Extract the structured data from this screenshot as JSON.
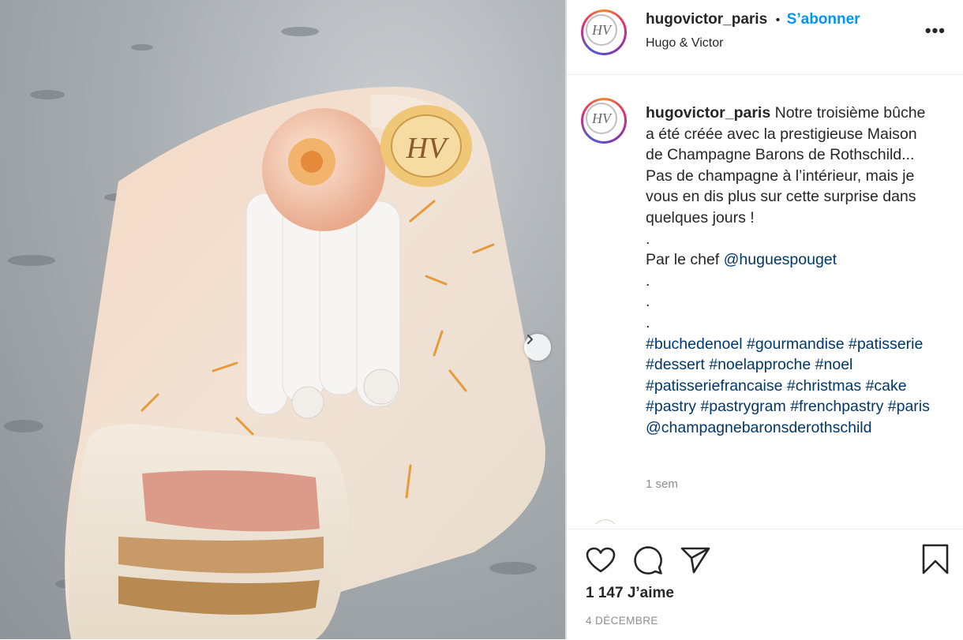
{
  "post": {
    "username": "hugovictor_paris",
    "follow_label": "S’abonner",
    "separator": "•",
    "location": "Hugo & Victor",
    "avatar_initials": "HV",
    "more_label": "•••"
  },
  "caption": {
    "username": "hugovictor_paris",
    "text": "Notre troisième bûche a été créée avec la prestigieuse Maison de Champagne Barons de Rothschild... Pas de champagne à l’intérieur, mais je vous en dis plus sur cette surprise dans quelques jours !",
    "dot1": ".",
    "chef_prefix": "Par le chef ",
    "chef_mention": "@huguespouget",
    "dot2": ".",
    "dot3": ".",
    "dot4": ".",
    "hashtags": [
      "#buchedenoel",
      "#gourmandise",
      "#patisserie",
      "#dessert",
      "#noelapproche",
      "#noel",
      "#patisseriefrancaise",
      "#christmas",
      "#cake",
      "#pastry",
      "#pastrygram",
      "#frenchpastry",
      "#paris"
    ],
    "mention_end": "@champagnebaronsderothschild",
    "time_ago": "1 sem"
  },
  "stats": {
    "likes": "1 147 J’aime",
    "date": "4 DÉCEMBRE"
  },
  "icons": {
    "like": "heart-icon",
    "comment": "comment-icon",
    "share": "paper-plane-icon",
    "save": "bookmark-icon",
    "next": "chevron-right-icon"
  },
  "colors": {
    "accent": "#0095f6",
    "link": "#00376b",
    "muted": "#8e8e8e"
  }
}
